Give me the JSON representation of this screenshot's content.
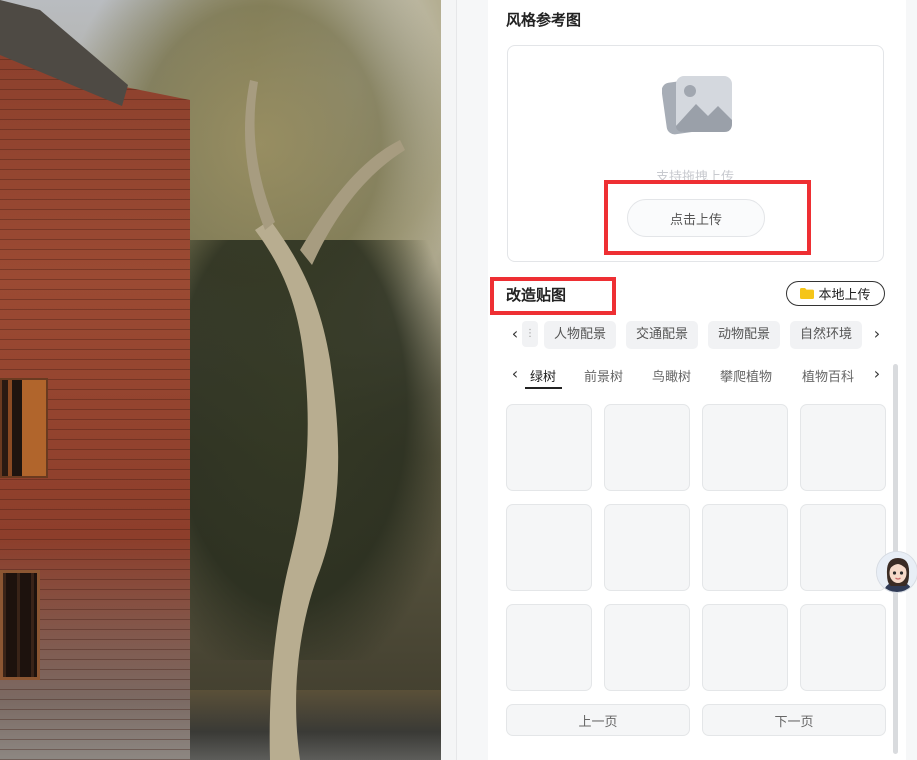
{
  "style_reference": {
    "title": "风格参考图",
    "drag_hint": "支持拖拽上传",
    "click_upload_label": "点击上传"
  },
  "remodel_stickers": {
    "title": "改造贴图",
    "local_upload_label": "本地上传",
    "categories": [
      "人物配景",
      "交通配景",
      "动物配景",
      "自然环境"
    ],
    "subcategories": [
      "绿树",
      "前景树",
      "鸟瞰树",
      "攀爬植物",
      "植物百科"
    ],
    "active_subcategory": "绿树",
    "prev_page_label": "上一页",
    "next_page_label": "下一页"
  },
  "icons": {
    "image_placeholder": "image-placeholder-icon",
    "folder": "folder-icon",
    "chevron_left": "chevron-left-icon",
    "chevron_right": "chevron-right-icon"
  },
  "colors": {
    "highlight": "#ee2f33",
    "folder": "#f5c518",
    "panel_bg": "#ffffff",
    "tile_bg": "#f5f6f7"
  }
}
